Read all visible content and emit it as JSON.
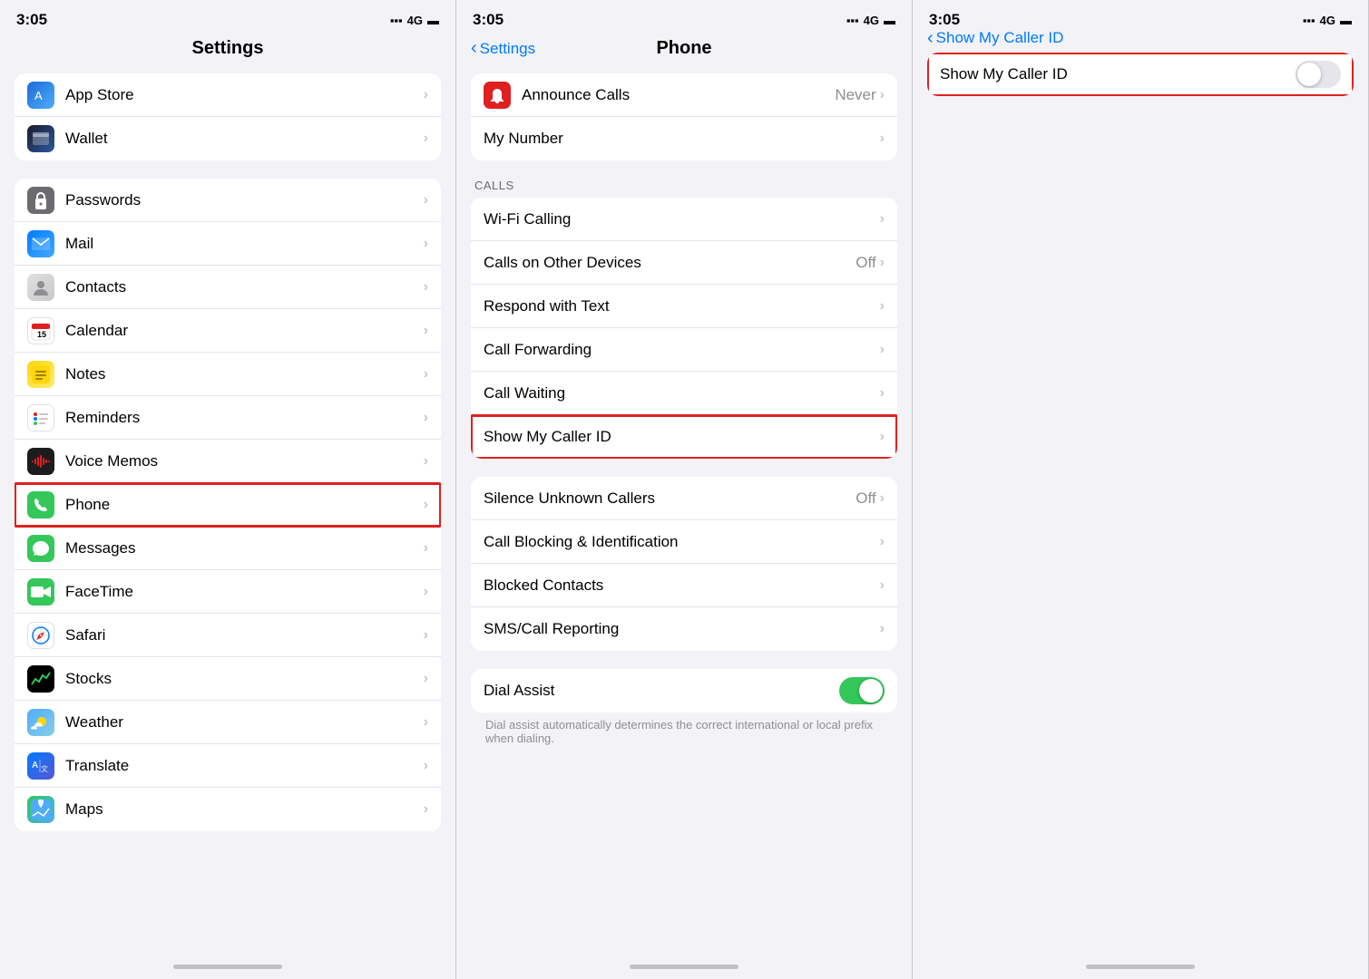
{
  "panels": {
    "panel1": {
      "statusTime": "3:05",
      "statusNetwork": "4G",
      "title": "Settings",
      "items": [
        {
          "id": "appstore",
          "label": "App Store",
          "icon": "appstore",
          "iconEmoji": "🅰"
        },
        {
          "id": "wallet",
          "label": "Wallet",
          "icon": "wallet",
          "iconEmoji": "💳"
        }
      ],
      "items2": [
        {
          "id": "passwords",
          "label": "Passwords",
          "icon": "passwords",
          "iconEmoji": "🔑"
        },
        {
          "id": "mail",
          "label": "Mail",
          "icon": "mail",
          "iconEmoji": "✉"
        },
        {
          "id": "contacts",
          "label": "Contacts",
          "icon": "contacts",
          "iconEmoji": "👤"
        },
        {
          "id": "calendar",
          "label": "Calendar",
          "icon": "calendar",
          "iconEmoji": "📅"
        },
        {
          "id": "notes",
          "label": "Notes",
          "icon": "notes",
          "iconEmoji": "📝"
        },
        {
          "id": "reminders",
          "label": "Reminders",
          "icon": "reminders",
          "iconEmoji": "⏰"
        },
        {
          "id": "voicememos",
          "label": "Voice Memos",
          "icon": "voicememos",
          "iconEmoji": "🎙"
        },
        {
          "id": "phone",
          "label": "Phone",
          "icon": "phone",
          "iconEmoji": "📞",
          "highlighted": true
        },
        {
          "id": "messages",
          "label": "Messages",
          "icon": "messages",
          "iconEmoji": "💬"
        },
        {
          "id": "facetime",
          "label": "FaceTime",
          "icon": "facetime",
          "iconEmoji": "📹"
        },
        {
          "id": "safari",
          "label": "Safari",
          "icon": "safari",
          "iconEmoji": "🧭"
        },
        {
          "id": "stocks",
          "label": "Stocks",
          "icon": "stocks",
          "iconEmoji": "📈"
        },
        {
          "id": "weather",
          "label": "Weather",
          "icon": "weather",
          "iconEmoji": "🌤"
        },
        {
          "id": "translate",
          "label": "Translate",
          "icon": "translate",
          "iconEmoji": "🌐"
        },
        {
          "id": "maps",
          "label": "Maps",
          "icon": "maps",
          "iconEmoji": "🗺"
        }
      ]
    },
    "panel2": {
      "statusTime": "3:05",
      "statusNetwork": "4G",
      "navBack": "Settings",
      "title": "Phone",
      "sections": {
        "top": [
          {
            "id": "announce",
            "label": "Announce Calls",
            "value": "Never",
            "icon": "announce"
          },
          {
            "id": "mynumber",
            "label": "My Number"
          }
        ],
        "callsLabel": "CALLS",
        "calls": [
          {
            "id": "wificalling",
            "label": "Wi-Fi Calling"
          },
          {
            "id": "callsother",
            "label": "Calls on Other Devices",
            "value": "Off"
          },
          {
            "id": "respondtext",
            "label": "Respond with Text"
          },
          {
            "id": "callforward",
            "label": "Call Forwarding"
          },
          {
            "id": "callwaiting",
            "label": "Call Waiting"
          },
          {
            "id": "showcallerid",
            "label": "Show My Caller ID",
            "highlighted": true
          }
        ],
        "bottom": [
          {
            "id": "silenceunknown",
            "label": "Silence Unknown Callers",
            "value": "Off"
          },
          {
            "id": "callblocking",
            "label": "Call Blocking & Identification"
          },
          {
            "id": "blockedcontacts",
            "label": "Blocked Contacts"
          },
          {
            "id": "smscallreporting",
            "label": "SMS/Call Reporting"
          }
        ],
        "dialSection": [
          {
            "id": "dialassist",
            "label": "Dial Assist",
            "toggle": true,
            "toggleOn": true
          }
        ],
        "dialDescription": "Dial assist automatically determines the correct international or local prefix when dialing."
      }
    },
    "panel3": {
      "statusTime": "3:05",
      "statusNetwork": "4G",
      "navBack": "Show My Caller ID",
      "setting": {
        "label": "Show My Caller ID",
        "toggleOn": false
      }
    }
  }
}
